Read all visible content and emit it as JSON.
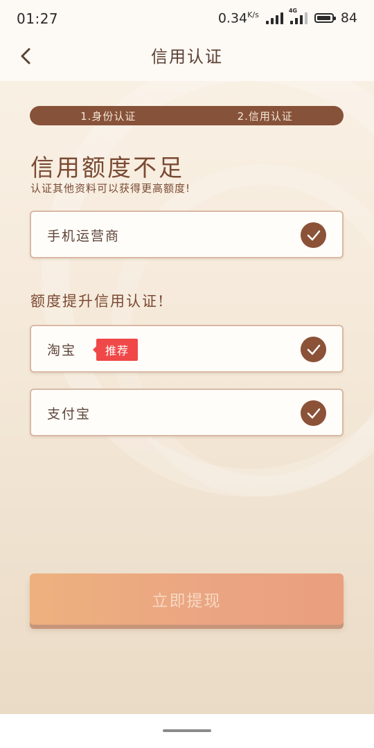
{
  "status_bar": {
    "time": "01:27",
    "speed": "0.34",
    "speed_unit": "K/s",
    "network": "4G",
    "battery": "84"
  },
  "header": {
    "title": "信用认证",
    "back_icon": "chevron-left-icon"
  },
  "steps": {
    "items": [
      "1.身份认证",
      "2.信用认证"
    ]
  },
  "intro": {
    "heading": "信用额度不足",
    "subheading": "认证其他资料可以获得更高额度!"
  },
  "basic_items": [
    {
      "label": "手机运营商",
      "status_icon": "check-icon"
    }
  ],
  "upgrade": {
    "title": "额度提升信用认证!",
    "items": [
      {
        "label": "淘宝",
        "badge": "推荐",
        "status_icon": "check-icon"
      },
      {
        "label": "支付宝",
        "status_icon": "check-icon"
      }
    ]
  },
  "actions": {
    "submit_label": "立即提现"
  },
  "colors": {
    "brand_brown": "#87523a",
    "badge_red": "#f04848",
    "button_orange": "#eba582"
  }
}
